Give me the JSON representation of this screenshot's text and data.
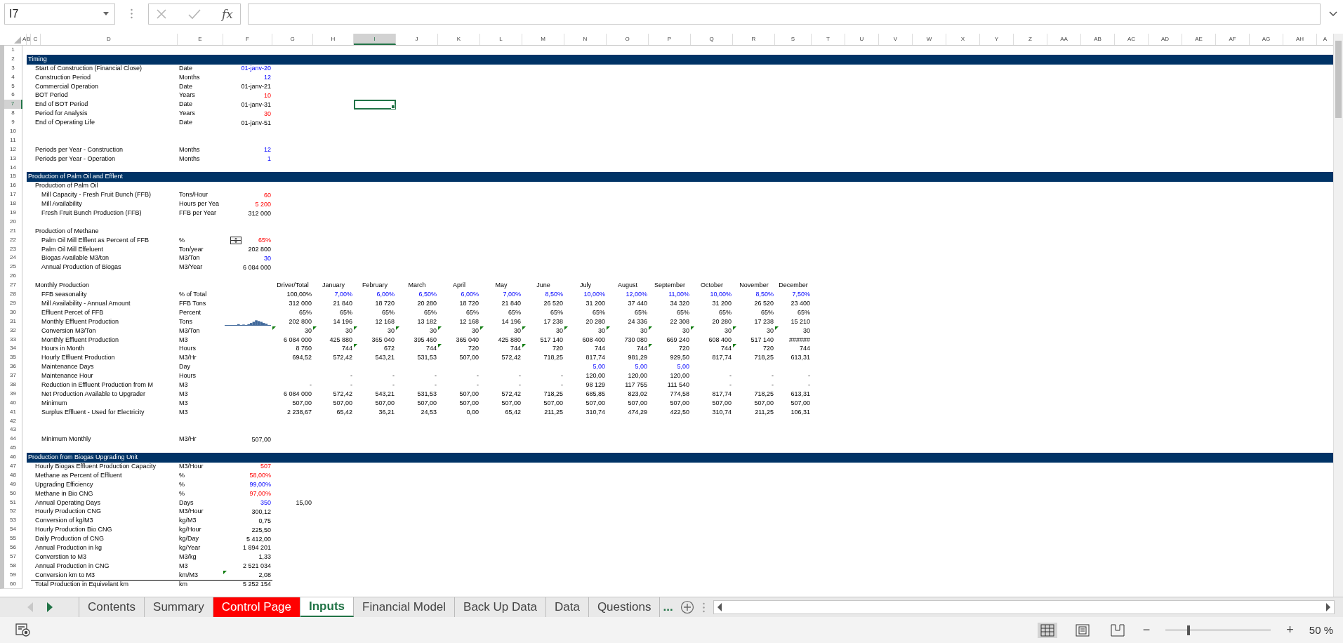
{
  "formula_bar": {
    "name_box": "I7",
    "function_label": "fx"
  },
  "columns": [
    {
      "label": "A",
      "selected": false
    },
    {
      "label": "B",
      "selected": false
    },
    {
      "label": "C",
      "selected": false
    },
    {
      "label": "D",
      "selected": false
    },
    {
      "label": "E",
      "selected": false
    },
    {
      "label": "F",
      "selected": false
    },
    {
      "label": "G",
      "selected": false
    },
    {
      "label": "H",
      "selected": false
    },
    {
      "label": "I",
      "selected": true
    },
    {
      "label": "J",
      "selected": false
    },
    {
      "label": "K",
      "selected": false
    },
    {
      "label": "L",
      "selected": false
    },
    {
      "label": "M",
      "selected": false
    },
    {
      "label": "N",
      "selected": false
    },
    {
      "label": "O",
      "selected": false
    },
    {
      "label": "P",
      "selected": false
    },
    {
      "label": "Q",
      "selected": false
    },
    {
      "label": "R",
      "selected": false
    },
    {
      "label": "S",
      "selected": false
    },
    {
      "label": "T",
      "selected": false
    },
    {
      "label": "U",
      "selected": false
    },
    {
      "label": "V",
      "selected": false
    },
    {
      "label": "W",
      "selected": false
    },
    {
      "label": "X",
      "selected": false
    },
    {
      "label": "Y",
      "selected": false
    },
    {
      "label": "Z",
      "selected": false
    },
    {
      "label": "AA",
      "selected": false
    },
    {
      "label": "AB",
      "selected": false
    },
    {
      "label": "AC",
      "selected": false
    },
    {
      "label": "AD",
      "selected": false
    },
    {
      "label": "AE",
      "selected": false
    },
    {
      "label": "AF",
      "selected": false
    },
    {
      "label": "AG",
      "selected": false
    },
    {
      "label": "AH",
      "selected": false
    },
    {
      "label": "A",
      "selected": false
    }
  ],
  "rows": [
    {
      "n": "1",
      "selected": false
    },
    {
      "n": "2",
      "selected": false,
      "kind": "section",
      "label": "Timing"
    },
    {
      "n": "3",
      "selected": false,
      "kind": "input",
      "indented": false,
      "label": "Start of Construction (Financial Close)",
      "unit": "Date",
      "value": "01-janv-20"
    },
    {
      "n": "4",
      "selected": false,
      "kind": "input",
      "indented": false,
      "label": "Construction Period",
      "unit": "Months",
      "value": "12"
    },
    {
      "n": "5",
      "selected": false,
      "kind": "calc",
      "indented": false,
      "label": "Commercial Operation",
      "unit": "Date",
      "value": "01-janv-21"
    },
    {
      "n": "6",
      "selected": false,
      "kind": "assumption",
      "indented": false,
      "label": "BOT Period",
      "unit": "Years",
      "value": "10"
    },
    {
      "n": "7",
      "selected": true,
      "kind": "calc",
      "indented": false,
      "label": "End of BOT Period",
      "unit": "Date",
      "value": "01-janv-31"
    },
    {
      "n": "8",
      "selected": false,
      "kind": "assumption",
      "indented": false,
      "label": "Period for Analysis",
      "unit": "Years",
      "value": "30"
    },
    {
      "n": "9",
      "selected": false,
      "kind": "calc",
      "indented": false,
      "label": "End of Operating Life",
      "unit": "Date",
      "value": "01-janv-51"
    },
    {
      "n": "10",
      "selected": false
    },
    {
      "n": "11",
      "selected": false
    },
    {
      "n": "12",
      "selected": false,
      "kind": "input",
      "indented": false,
      "label": "Periods per Year - Construction",
      "unit": "Months",
      "value": "12"
    },
    {
      "n": "13",
      "selected": false,
      "kind": "input",
      "indented": false,
      "label": "Periods per Year - Operation",
      "unit": "Months",
      "value": "1"
    },
    {
      "n": "14",
      "selected": false
    },
    {
      "n": "15",
      "selected": false,
      "kind": "section",
      "label": "Production of Palm Oil and Efflent"
    },
    {
      "n": "16",
      "selected": false,
      "indented": false,
      "label": "Production of Palm Oil"
    },
    {
      "n": "17",
      "selected": false,
      "kind": "assumption",
      "indented": true,
      "label": "Mill Capacity - Fresh Fruit Bunch (FFB)",
      "unit": "Tons/Hour",
      "value": "60"
    },
    {
      "n": "18",
      "selected": false,
      "kind": "assumption",
      "indented": true,
      "label": "Mill Availability",
      "unit": "Hours per Yea",
      "value": "5 200"
    },
    {
      "n": "19",
      "selected": false,
      "kind": "calc",
      "indented": true,
      "label": "Fresh Fruit Bunch Production (FFB)",
      "unit": "FFB per Year",
      "value": "312 000"
    },
    {
      "n": "20",
      "selected": false
    },
    {
      "n": "21",
      "selected": false,
      "indented": false,
      "label": "Production of Methane"
    },
    {
      "n": "22",
      "selected": false,
      "kind": "assumption",
      "indented": true,
      "label": "Palm Oil Mill Efflent as Percent of FFB",
      "unit": "%",
      "spinner": true,
      "value": "65%"
    },
    {
      "n": "23",
      "selected": false,
      "kind": "calc",
      "indented": true,
      "label": "Palm Oil Mill Effeluent",
      "unit": "Ton/year",
      "value": "202 800"
    },
    {
      "n": "24",
      "selected": false,
      "kind": "input",
      "indented": true,
      "label": "Biogas Available M3/ton",
      "unit": "M3/Ton",
      "value": "30"
    },
    {
      "n": "25",
      "selected": false,
      "kind": "calc",
      "indented": true,
      "label": "Annual Production of Biogas",
      "unit": "M3/Year",
      "value": "6 084 000"
    },
    {
      "n": "26",
      "selected": false
    },
    {
      "n": "27",
      "selected": false,
      "indented": false,
      "label": "Monthly Production",
      "headers": [
        "Driver/Total",
        "January",
        "February",
        "March",
        "April",
        "May",
        "June",
        "July",
        "August",
        "September",
        "October",
        "November",
        "December"
      ]
    },
    {
      "n": "28",
      "selected": false,
      "kind": "input",
      "indented": true,
      "label": "FFB seasonality",
      "unit": "% of Total",
      "driver": "100,00%",
      "months": [
        "7,00%",
        "6,00%",
        "6,50%",
        "6,00%",
        "7,00%",
        "8,50%",
        "10,00%",
        "12,00%",
        "11,00%",
        "10,00%",
        "8,50%",
        "7,50%"
      ]
    },
    {
      "n": "29",
      "selected": false,
      "kind": "calc",
      "indented": true,
      "label": "Mill Availability - Annual Amount",
      "unit": "FFB Tons",
      "driver": "312 000",
      "months": [
        "21 840",
        "18 720",
        "20 280",
        "18 720",
        "21 840",
        "26 520",
        "31 200",
        "37 440",
        "34 320",
        "31 200",
        "26 520",
        "23 400"
      ]
    },
    {
      "n": "30",
      "selected": false,
      "kind": "calc",
      "indented": true,
      "label": "Effluent Percet of FFB",
      "unit": "Percent",
      "driver": "65%",
      "months": [
        "65%",
        "65%",
        "65%",
        "65%",
        "65%",
        "65%",
        "65%",
        "65%",
        "65%",
        "65%",
        "65%",
        "65%"
      ]
    },
    {
      "n": "31",
      "selected": false,
      "kind": "calc",
      "indented": true,
      "label": "Monthly Effluent Production",
      "unit": "Tons",
      "sparkline": true,
      "driver": "202 800",
      "months": [
        "14 196",
        "12 168",
        "13 182",
        "12 168",
        "14 196",
        "17 238",
        "20 280",
        "24 336",
        "22 308",
        "20 280",
        "17 238",
        "15 210"
      ]
    },
    {
      "n": "32",
      "selected": false,
      "kind": "calc",
      "indented": true,
      "label": "Conversion M3/Ton",
      "unit": "M3/Ton",
      "driver": "30",
      "months": [
        "30",
        "30",
        "30",
        "30",
        "30",
        "30",
        "30",
        "30",
        "30",
        "30",
        "30",
        "30"
      ],
      "value_flags": [
        true,
        true,
        true,
        true,
        true,
        true,
        true,
        true,
        true,
        true,
        true,
        true,
        true
      ]
    },
    {
      "n": "33",
      "selected": false,
      "kind": "calc",
      "indented": true,
      "label": "Monthly Effluent Production",
      "unit": "M3",
      "driver": "6 084 000",
      "months": [
        "425 880",
        "365 040",
        "395 460",
        "365 040",
        "425 880",
        "517 140",
        "608 400",
        "730 080",
        "669 240",
        "608 400",
        "517 140",
        "######"
      ]
    },
    {
      "n": "34",
      "selected": false,
      "kind": "calc",
      "indented": true,
      "label": "Hours in Month",
      "unit": "Hours",
      "driver": "8 760",
      "months": [
        "744",
        "672",
        "744",
        "720",
        "744",
        "720",
        "744",
        "744",
        "720",
        "744",
        "720",
        "744"
      ],
      "value_flags": [
        false,
        false,
        true,
        false,
        true,
        false,
        true,
        false,
        false,
        true,
        false,
        true,
        false
      ]
    },
    {
      "n": "35",
      "selected": false,
      "kind": "calc",
      "indented": true,
      "label": "Hourly Effluent Production",
      "unit": "M3/Hr",
      "driver": "694,52",
      "months": [
        "572,42",
        "543,21",
        "531,53",
        "507,00",
        "572,42",
        "718,25",
        "817,74",
        "981,29",
        "929,50",
        "817,74",
        "718,25",
        "613,31"
      ]
    },
    {
      "n": "36",
      "selected": false,
      "kind": "input",
      "indented": true,
      "label": "Maintenance Days",
      "unit": "Day",
      "months": [
        {
          "flagged": false
        },
        {
          "flagged": false
        },
        {
          "flagged": false
        },
        {
          "flagged": false
        },
        {
          "flagged": false
        },
        {
          "flagged": false
        },
        {
          "text": "5,00",
          "flagged": false
        },
        {
          "text": "5,00",
          "flagged": false
        },
        {
          "text": "5,00",
          "flagged": false
        },
        {
          "flagged": false
        },
        {
          "flagged": false
        },
        {
          "flagged": false
        }
      ]
    },
    {
      "n": "37",
      "selected": false,
      "kind": "calc",
      "indented": true,
      "label": "Maintenance Hour",
      "unit": "Hours",
      "months": [
        "-",
        "-",
        "-",
        "-",
        "-",
        "-",
        "120,00",
        "120,00",
        "120,00",
        "-",
        "-",
        "-"
      ]
    },
    {
      "n": "38",
      "selected": false,
      "kind": "calc",
      "indented": true,
      "label": "Reduction in Effluent Production from M",
      "unit": "M3",
      "driver": "-",
      "months": [
        "-",
        "-",
        "-",
        "-",
        "-",
        "-",
        "98 129",
        "117 755",
        "111 540",
        "-",
        "-",
        "-"
      ]
    },
    {
      "n": "39",
      "selected": false,
      "kind": "calc",
      "indented": true,
      "label": "Net Production Available to Upgrader",
      "unit": "M3",
      "driver": "6 084 000",
      "months": [
        "572,42",
        "543,21",
        "531,53",
        "507,00",
        "572,42",
        "718,25",
        "685,85",
        "823,02",
        "774,58",
        "817,74",
        "718,25",
        "613,31"
      ]
    },
    {
      "n": "40",
      "selected": false,
      "kind": "calc",
      "indented": true,
      "label": "Minimum",
      "unit": "M3",
      "driver": "507,00",
      "months": [
        "507,00",
        "507,00",
        "507,00",
        "507,00",
        "507,00",
        "507,00",
        "507,00",
        "507,00",
        "507,00",
        "507,00",
        "507,00",
        "507,00"
      ]
    },
    {
      "n": "41",
      "selected": false,
      "kind": "calc",
      "indented": true,
      "label": "Surplus Effluent - Used for Electricity",
      "unit": "M3",
      "driver": "2 238,67",
      "months": [
        "65,42",
        "36,21",
        "24,53",
        "0,00",
        "65,42",
        "211,25",
        "310,74",
        "474,29",
        "422,50",
        "310,74",
        "211,25",
        "106,31"
      ]
    },
    {
      "n": "42",
      "selected": false
    },
    {
      "n": "43",
      "selected": false
    },
    {
      "n": "44",
      "selected": false,
      "kind": "calc",
      "indented": true,
      "label": "Minimum Monthly",
      "unit": "M3/Hr",
      "value": "507,00"
    },
    {
      "n": "45",
      "selected": false
    },
    {
      "n": "46",
      "selected": false,
      "kind": "section",
      "label": "Production from Biogas Upgrading Unit"
    },
    {
      "n": "47",
      "selected": false,
      "kind": "assumption",
      "indented": false,
      "label": "Hourly Biogas Effluent Production Capacity",
      "unit": "M3/Hour",
      "value": "507"
    },
    {
      "n": "48",
      "selected": false,
      "kind": "assumption",
      "indented": false,
      "label": "Methane as Percent of Effluent",
      "unit": "%",
      "value": "58,00%"
    },
    {
      "n": "49",
      "selected": false,
      "kind": "input",
      "indented": false,
      "label": "Upgrading Efficiency",
      "unit": "%",
      "value": "99,00%"
    },
    {
      "n": "50",
      "selected": false,
      "kind": "assumption",
      "indented": false,
      "label": "Methane in Bio CNG",
      "unit": "%",
      "value": "97,00%"
    },
    {
      "n": "51",
      "selected": false,
      "kind": "input",
      "indented": false,
      "label": "Annual Operating Days",
      "unit": "Days",
      "value": "350",
      "driver": "15,00"
    },
    {
      "n": "52",
      "selected": false,
      "kind": "calc",
      "indented": false,
      "label": "Hourly Production CNG",
      "unit": "M3/Hour",
      "value": "300,12"
    },
    {
      "n": "53",
      "selected": false,
      "kind": "calc",
      "indented": false,
      "label": "Conversion of kg/M3",
      "unit": "kg/M3",
      "value": "0,75"
    },
    {
      "n": "54",
      "selected": false,
      "kind": "calc",
      "indented": false,
      "label": "Hourly Production Bio CNG",
      "unit": "kg/Hour",
      "value": "225,50"
    },
    {
      "n": "55",
      "selected": false,
      "kind": "calc",
      "indented": false,
      "label": "Daily Production of CNG",
      "unit": "kg/Day",
      "value": "5 412,00"
    },
    {
      "n": "56",
      "selected": false,
      "kind": "calc",
      "indented": false,
      "label": "Annual Production in kg",
      "unit": "kg/Year",
      "value": "1 894 201"
    },
    {
      "n": "57",
      "selected": false,
      "kind": "calc",
      "indented": false,
      "label": "Converstion to M3",
      "unit": "M3/kg",
      "value": "1,33"
    },
    {
      "n": "58",
      "selected": false,
      "kind": "calc",
      "indented": false,
      "label": "Annual Production in CNG",
      "unit": "M3",
      "value": "2 521 034"
    },
    {
      "n": "59",
      "selected": false,
      "kind": "calc",
      "indented": false,
      "label": "Conversion km to M3",
      "unit": "km/M3",
      "value": "2,08",
      "flagged": true,
      "underline": true
    },
    {
      "n": "60",
      "selected": false,
      "kind": "calc",
      "indented": false,
      "label": "Total Production in Equivelant km",
      "unit": "km",
      "value": "5 252 154"
    }
  ],
  "tabs": [
    {
      "label": "Contents",
      "selected": false
    },
    {
      "label": "Summary",
      "selected": false
    },
    {
      "label": "Control Page",
      "selected": false,
      "color": "#ff0000"
    },
    {
      "label": "Inputs",
      "selected": true
    },
    {
      "label": "Financial Model",
      "selected": false
    },
    {
      "label": "Back Up Data",
      "selected": false
    },
    {
      "label": "Data",
      "selected": false
    },
    {
      "label": "Questions",
      "selected": false
    }
  ],
  "more_tabs": "...",
  "views": [
    {
      "kind": "normal",
      "selected": true
    },
    {
      "kind": "page_layout",
      "selected": false
    },
    {
      "kind": "page_break",
      "selected": false
    }
  ],
  "zoom": {
    "out_label": "−",
    "level": 0.22,
    "in_label": "+",
    "reading": "50 %"
  }
}
